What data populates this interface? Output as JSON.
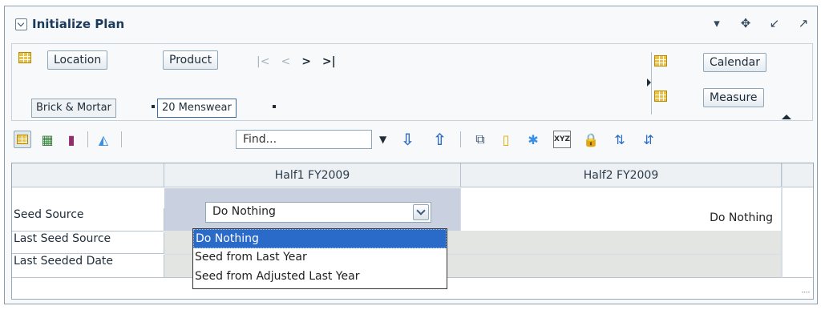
{
  "window": {
    "title": "Initialize Plan",
    "icons": [
      "dropdown-icon",
      "move-icon",
      "minimize-icon",
      "maximize-icon"
    ]
  },
  "pivot": {
    "row_dims": [
      "Location",
      "Product"
    ],
    "col_dims": [
      "Calendar",
      "Measure"
    ],
    "members": [
      "Brick & Mortar",
      "20 Menswear"
    ],
    "nav": [
      "|<",
      "<",
      ">",
      ">|"
    ]
  },
  "toolbar": {
    "find_placeholder": "Find...",
    "icons": [
      "table-view-icon",
      "chart-table-icon",
      "bar-chart-icon",
      "area-chart-icon",
      "find-dropdown-icon",
      "find-next-icon",
      "find-previous-icon",
      "export-icon",
      "ruler-icon",
      "highlight-icon",
      "xyz-icon",
      "lock-icon",
      "sort-ascending-icon",
      "sort-descending-icon"
    ]
  },
  "table": {
    "columns": [
      "Half1 FY2009",
      "Half2 FY2009"
    ],
    "rows": [
      {
        "label": "Seed Source",
        "col1": "Do Nothing",
        "col2": "Do Nothing"
      },
      {
        "label": "Last Seed Source",
        "col1": "",
        "col2": ""
      },
      {
        "label": "Last Seeded Date",
        "col1": "",
        "col2": ""
      }
    ]
  },
  "dropdown": {
    "selected": "Do Nothing",
    "options": [
      "Do Nothing",
      "Seed from Last Year",
      "Seed from Adjusted Last Year"
    ]
  },
  "colors": {
    "accent": "#2a6ac9",
    "header_bg": "#eef1f4",
    "selected_col_bg": "#c9d1e0",
    "grey_cell_bg": "#e3e5e2"
  }
}
